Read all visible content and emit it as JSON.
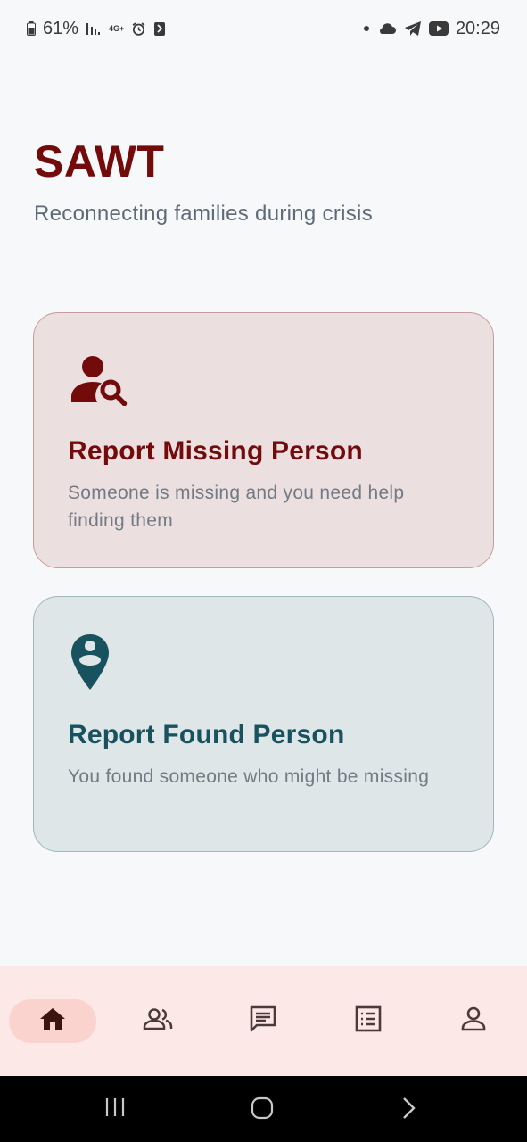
{
  "status_bar": {
    "battery": "61%",
    "network_type": "4G+",
    "time": "20:29",
    "left_icons": [
      "battery-icon",
      "signal-icon",
      "network-4g-icon",
      "alarm-icon",
      "nfc-icon"
    ],
    "right_icons": [
      "dot-icon",
      "cloud-icon",
      "telegram-icon",
      "youtube-icon"
    ]
  },
  "header": {
    "title": "SAWT",
    "subtitle": "Reconnecting families during crisis"
  },
  "cards": {
    "missing": {
      "title": "Report Missing Person",
      "description": "Someone is missing and you need help finding them",
      "icon": "person-search-icon",
      "color": "#730b0b"
    },
    "found": {
      "title": "Report Found Person",
      "description": "You found someone who might be missing",
      "icon": "person-pin-icon",
      "color": "#18525f"
    }
  },
  "bottom_nav": {
    "items": [
      {
        "icon": "home-icon",
        "active": true
      },
      {
        "icon": "people-icon",
        "active": false
      },
      {
        "icon": "chat-icon",
        "active": false
      },
      {
        "icon": "list-icon",
        "active": false
      },
      {
        "icon": "profile-icon",
        "active": false
      }
    ],
    "background": "#fce8e6",
    "active_pill": "#fad3cf"
  },
  "system_nav": {
    "buttons": [
      "recent-apps-icon",
      "home-button-icon",
      "back-icon"
    ]
  }
}
